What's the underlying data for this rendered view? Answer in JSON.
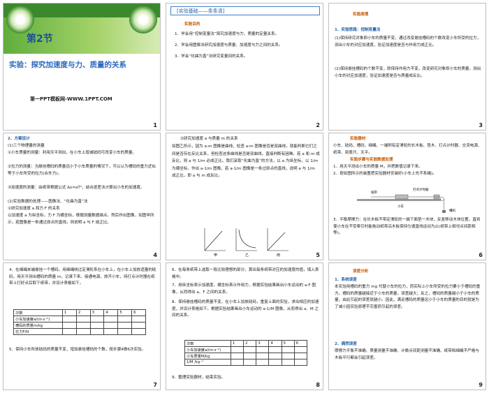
{
  "slides": [
    {
      "number": "1",
      "section": "第2节",
      "title": "实验：探究加速度与力、质量的关系",
      "footer": "第一PPT模板网-WWW.1PPT.COM"
    },
    {
      "number": "2",
      "header": "[实验基础——条条清]",
      "heading": "实验目的",
      "items": [
        "1．学会用“控制变量法”探究加速度与力、质量的定量关系。",
        "2．学会用图像法研究加速度与质量、加速度与力之间的关系。",
        "3．学会“化曲为直”法研究变量间的关系。"
      ]
    },
    {
      "number": "3",
      "heading": "实验原理",
      "sub1": "1．实验思路：控制变量法",
      "p1": "(1)保持研究对象即小车的质量不变，通过改变悬挂槽码的个数改变小车所受的拉力，测出小车的对应加速度，验证加速度是否与作用力成正比。",
      "p2": "(2)保持悬挂槽码的个数不变，即保持作用力不变，改变研究对象即小车的质量，测出小车的对应加速度，验证加速度是否与质量成反比。"
    },
    {
      "number": "4",
      "sub": "2．方案设计",
      "lines": [
        "(1)三个物理量的测量",
        "①小车质量的测量：利用天平测出，在小车上增减砝码可改变小车的质量。",
        "②拉力的测量：当悬挂槽码的质量远小于小车质量的情况下，可以认为槽码的重力近似等于小车所受的拉力(合外力)。",
        "③加速度的测量：由纸带根据公式 Δx=aT²，结合逐差法计算出小车的加速度。",
        "(2)实验数据的处理——图像法、“化曲为直”法",
        "①研究加速度 a 和力 F 的关系",
        "以加速度 a 为纵坐标，力 F 为横坐标，根据测量数据描点，然后作出图像，如图甲所示，若图像是一条通过原点的直线，则说明 a 与 F 成正比。"
      ]
    },
    {
      "number": "5",
      "lines": [
        "②研究加速度 a 与质量 m 的关系",
        "如图乙所示，因为 a-m 图像是曲线，检查 a-m 图像是否是双曲线，就能判断它们之间是否存在反比关系，但检查这条曲线是否是双曲线，直接判断有困难。若 a 和 m 成反比，则 a 与 1/m 必成正比。我们采取“化曲为直”的方法，以 a 为纵坐标，以 1/m 为横坐标，作出 a-1/m 图像，若 a-1/m 图像是一条过原点的直线，说明 a 与 1/m 成正比，即 a 与 m 成反比。"
      ],
      "graph_labels": [
        "甲",
        "乙",
        "丙"
      ]
    },
    {
      "number": "6",
      "heading": "实验器材",
      "p": "小车、砝码、槽码、细绳、一端附有定滑轮的长木板、垫木、打点计时器、交流电源、纸带、刻度尺、天平。",
      "heading2": "实验步骤与实验数据处理",
      "steps": [
        "1．用天平测出小车的质量 M，并把数值记录下来。",
        "2．按如图所示的装置把实验器材安装好(小车上先不系绳)。",
        "3．平衡摩擦力：在长木板不带定滑轮的一端下面垫一木块，反复移动木块位置，直到使小车在不受牵引时能拖动纸带沿木板保持匀速直线运动为止(纸带上相邻点间距相等)。"
      ],
      "diagram_labels": [
        "纸带",
        "打点计时器",
        "小车",
        "槽码"
      ]
    },
    {
      "number": "7",
      "p4": "4．在细绳末端悬挂一个槽码，用细绳绕过定滑轮系在小车上，在小车上加放适量的砝码，用天平测出槽码的质量 m，记录下来。接通电源，放开小车，待打点计时器在纸带上打好点后取下纸带，并设计表格如下。",
      "table": {
        "header": [
          "次数",
          "1",
          "2",
          "3",
          "4",
          "5",
          "6"
        ],
        "rows": [
          "小车加速度a/(m·s⁻²)",
          "槽码的质量m/kg",
          "拉力F/N"
        ]
      },
      "p5": "5．保持小车所放砝码的质量不变，增加悬挂槽码的个数，按步骤4做6次实验。"
    },
    {
      "number": "8",
      "p6": "6．在每条纸带上选取一段比较理想的部分，算出每条纸带对应的加速度的值，填入表格中。",
      "p7": "7．用纵坐标表示加速度，横坐标表示作用力，根据实验结果画出小车运动的 a-F 图像，从而得出 a、F 之间的关系。",
      "p8": "8．保持悬挂槽码的质量不变，在小车上加放砝码，重复上面的实验，求出相应的加速度，并设计表格如下。根据实验结果画出小车运动的 a-1/M 图像，从而得出 a、M 之间的关系。",
      "table": {
        "header": [
          "次数",
          "1",
          "2",
          "3",
          "4",
          "5",
          "6"
        ],
        "rows": [
          "小车加速度a/(m·s⁻²)",
          "小车质量M/kg",
          "1/M /kg⁻¹"
        ]
      },
      "p9": "9．整理实验器材，结束实验。"
    },
    {
      "number": "9",
      "heading": "误差分析",
      "sub1": "1．系统误差",
      "p1": "本实验用槽码的重力 mg 代替小车的拉力，而实际上小车所受的拉力要小于槽码的重力。槽码的质量越接近于小车的质量，误差越大；反之，槽码的质量越小于小车的质量，由此引起的误差就越小。因此，满足槽码的质量远小于小车的质量的目的就是为了减小因实验原理不完善而引起的误差。",
      "sub2": "2．偶然误差",
      "p2": "摩擦力平衡不准确、质量测量不准确、计数点间距测量不准确、纸带和细绳不严格与木板平行都会引起误差。"
    }
  ]
}
